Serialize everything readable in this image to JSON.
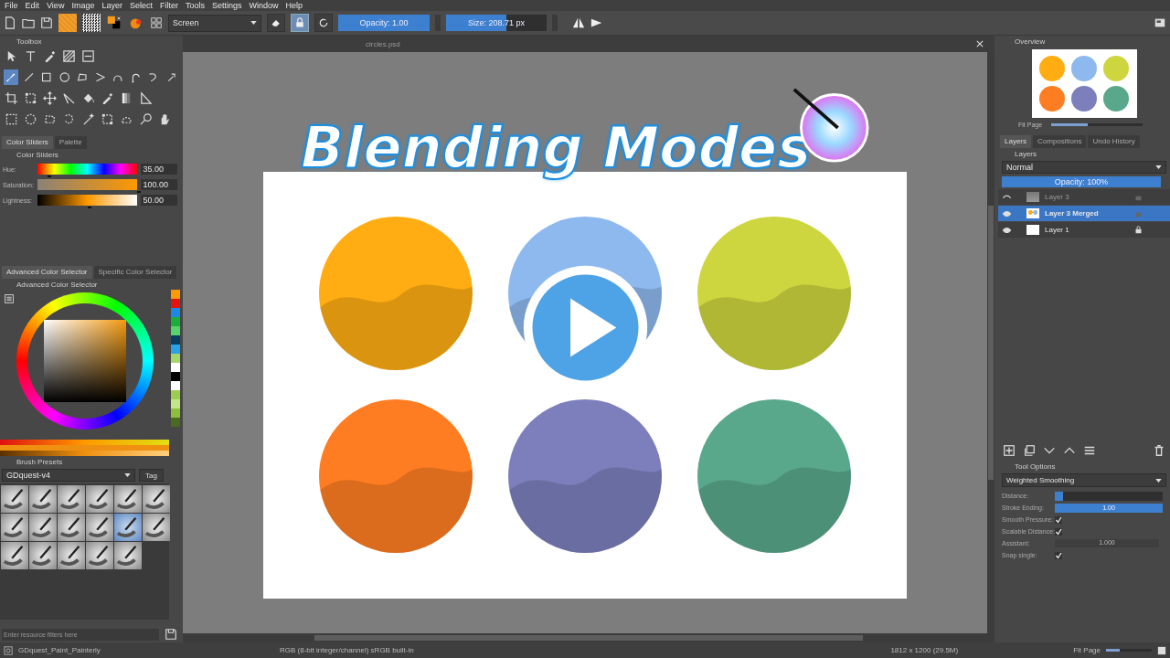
{
  "menu": [
    "File",
    "Edit",
    "View",
    "Image",
    "Layer",
    "Select",
    "Filter",
    "Tools",
    "Settings",
    "Window",
    "Help"
  ],
  "toolbar": {
    "blend_mode": "Screen",
    "erase_on": false,
    "preserve_alpha_on": true,
    "opacity": {
      "label": "Opacity:  1.00",
      "level": 1
    },
    "size": {
      "label": "Size:  208.71 px",
      "level": 0.6
    }
  },
  "toolbox": {
    "title": "Toolbox",
    "rows": [
      [
        {
          "kind": "pointer",
          "selected": false
        },
        {
          "kind": "text",
          "selected": false
        },
        {
          "kind": "pen",
          "selected": false
        },
        {
          "kind": "pattern",
          "selected": false
        },
        {
          "kind": "frame",
          "selected": false
        }
      ],
      [
        {
          "kind": "brush",
          "selected": true
        },
        {
          "kind": "line",
          "selected": false
        },
        {
          "kind": "rect",
          "selected": false
        },
        {
          "kind": "ellipse",
          "selected": false
        },
        {
          "kind": "polygon",
          "selected": false
        },
        {
          "kind": "polyline",
          "selected": false
        },
        {
          "kind": "bezier",
          "selected": false
        },
        {
          "kind": "path",
          "selected": false
        },
        {
          "kind": "curve",
          "selected": false
        },
        {
          "kind": "spray",
          "selected": false
        }
      ],
      [
        {
          "kind": "crop",
          "selected": false
        },
        {
          "kind": "transform",
          "selected": false
        },
        {
          "kind": "move",
          "selected": false
        },
        {
          "kind": "measure",
          "selected": false
        },
        {
          "kind": "bucket",
          "selected": false
        },
        {
          "kind": "pen",
          "selected": false
        },
        {
          "kind": "gradient",
          "selected": false
        },
        {
          "kind": "ruler",
          "selected": false
        }
      ],
      [
        {
          "kind": "rect-select",
          "selected": false
        },
        {
          "kind": "ellipse-select",
          "selected": false
        },
        {
          "kind": "poly-select",
          "selected": false
        },
        {
          "kind": "free-select",
          "selected": false
        },
        {
          "kind": "wand",
          "selected": false
        },
        {
          "kind": "transform",
          "selected": false
        },
        {
          "kind": "bezier-select",
          "selected": false
        },
        {
          "kind": "zoom",
          "selected": false
        },
        {
          "kind": "hand",
          "selected": false
        }
      ]
    ]
  },
  "color_sliders": {
    "tabs": [
      {
        "label": "Color Sliders",
        "selected": true
      },
      {
        "label": "Palette",
        "selected": false
      }
    ],
    "title": "Color Sliders",
    "rows": [
      {
        "kind": "hue",
        "label": "Hue:",
        "value": "35.00",
        "level": 0.1
      },
      {
        "kind": "saturation",
        "label": "Saturation:",
        "value": "100.00",
        "level": 1
      },
      {
        "kind": "lightness",
        "label": "Lightness:",
        "value": "50.00",
        "level": 0.5
      }
    ]
  },
  "color_selector": {
    "tabs": [
      {
        "label": "Advanced Color Selector",
        "selected": true
      },
      {
        "label": "Specific Color Selector",
        "selected": false
      }
    ],
    "title": "Advanced Color Selector",
    "swatches": [
      {
        "color": "#ff9900"
      },
      {
        "color": "#e8130f"
      },
      {
        "color": "#1e88e5"
      },
      {
        "color": "#1aae3a"
      },
      {
        "color": "#56d36b"
      },
      {
        "color": "#0a3d62"
      },
      {
        "color": "#29a3e8"
      },
      {
        "color": "#a5d86a"
      },
      {
        "color": "#ffffff"
      },
      {
        "color": "#000000"
      },
      {
        "color": "#fefefe"
      },
      {
        "color": "#9ccc50"
      },
      {
        "color": "#c4e68a"
      },
      {
        "color": "#8cbf3a"
      },
      {
        "color": "#4a6a22"
      }
    ]
  },
  "brush_presets": {
    "title": "Brush Presets",
    "set": "GDquest-v4",
    "tag": "Tag",
    "filter_placeholder": "Enter resource filters here",
    "presets": [
      {
        "selected": false
      },
      {
        "selected": false
      },
      {
        "selected": false
      },
      {
        "selected": false
      },
      {
        "selected": false
      },
      {
        "selected": false
      },
      {
        "selected": false
      },
      {
        "selected": false
      },
      {
        "selected": false
      },
      {
        "selected": false
      },
      {
        "selected": true
      },
      {
        "selected": false
      },
      {
        "selected": false
      },
      {
        "selected": false
      },
      {
        "selected": false
      },
      {
        "selected": false
      },
      {
        "selected": false
      }
    ]
  },
  "document": {
    "tab": "circles.psd",
    "title": "Blending Modes",
    "circles": [
      {
        "color": "#ffad12"
      },
      {
        "color": "#8db9ee"
      },
      {
        "color": "#cdd63e"
      },
      {
        "color": "#ff7d22"
      },
      {
        "color": "#7c7fbc"
      },
      {
        "color": "#5aa88c"
      }
    ]
  },
  "overview": {
    "title": "Overview",
    "zoom": {
      "label": "Fit Page",
      "level": 0.4
    }
  },
  "dock_tabs": [
    {
      "label": "Layers",
      "selected": true
    },
    {
      "label": "Compositions",
      "selected": false
    },
    {
      "label": "Undo History",
      "selected": false
    }
  ],
  "layers": {
    "title": "Layers",
    "blend_mode": "Normal",
    "opacity": {
      "label": "Opacity:  100%",
      "level": 1
    },
    "items": [
      {
        "name": "Layer 3",
        "kind": "strip",
        "visible": false,
        "selected": false,
        "locked": false
      },
      {
        "name": "Layer 3 Merged",
        "kind": "circles",
        "visible": true,
        "selected": true,
        "locked": false
      },
      {
        "name": "Layer 1",
        "kind": "white",
        "visible": true,
        "selected": false,
        "locked": true
      }
    ]
  },
  "tool_options": {
    "title": "Tool Options",
    "mode": "Weighted Smoothing",
    "rows": [
      {
        "kind": "slider",
        "label": "Distance:",
        "level": 0.08
      },
      {
        "kind": "slider",
        "label": "Stroke Ending:",
        "value": "1.00",
        "level": 1
      },
      {
        "kind": "check",
        "label": "Smooth Pressure:",
        "checked": true
      },
      {
        "kind": "check",
        "label": "Scalable Distance:",
        "checked": true
      },
      {
        "kind": "spin",
        "label": "Assistant:",
        "value": "1.000"
      },
      {
        "kind": "check",
        "label": "Snap single:",
        "checked": true
      }
    ]
  },
  "status_bar": {
    "preset": "GDquest_Paint_Painterly",
    "color_space": "RGB (8-bit integer/channel)  sRGB built-in",
    "size": "1812 x 1200 (29.5M)",
    "zoom": {
      "label": "Fit Page",
      "level": 0.3
    }
  }
}
